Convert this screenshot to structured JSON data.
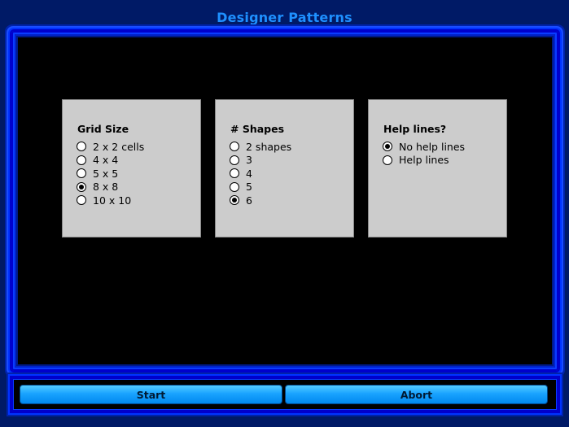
{
  "app": {
    "title": "Designer Patterns"
  },
  "panels": {
    "grid": {
      "title": "Grid Size",
      "options": [
        "2 x 2 cells",
        "4 x 4",
        "5 x 5",
        "8 x 8",
        "10 x 10"
      ],
      "selected": "8 x 8"
    },
    "shapes": {
      "title": "# Shapes",
      "options": [
        "2 shapes",
        "3",
        "4",
        "5",
        "6"
      ],
      "selected": "6"
    },
    "help": {
      "title": "Help lines?",
      "options": [
        "No help lines",
        "Help lines"
      ],
      "selected": "No help lines"
    }
  },
  "buttons": {
    "start": "Start",
    "abort": "Abort"
  },
  "colors": {
    "background": "#001a66",
    "title": "#1e90ff",
    "panel": "#cccccc",
    "button": "#1aa3ff"
  }
}
